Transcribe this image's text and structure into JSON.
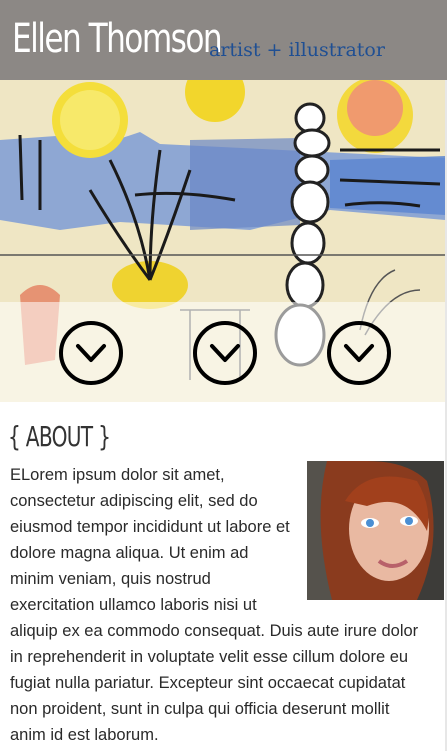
{
  "header": {
    "title": "Ellen Thomson",
    "tagline": "artist + illustrator"
  },
  "hero": {
    "image_alt": "painting",
    "nav_buttons": [
      "chevron-down-icon",
      "chevron-down-icon",
      "chevron-down-icon"
    ]
  },
  "about": {
    "heading": "{ ABOUT }",
    "photo_alt": "portrait photo",
    "paragraph": "ELorem ipsum dolor sit amet, consectetur adipiscing elit, sed do eiusmod tempor incididunt ut labore et dolore magna aliqua. Ut enim ad minim veniam, quis nostrud exercitation ullamco laboris nisi ut aliquip ex ea commodo consequat. Duis aute irure dolor in reprehenderit in voluptate velit esse cillum dolore eu fugiat nulla pariatur. Excepteur sint occaecat cupidatat non proident, sunt in culpa qui officia deserunt mollit anim id est laborum."
  },
  "colors": {
    "header_bg": "#8c8885",
    "title": "#ffffff",
    "tagline": "#1f4f93",
    "text": "#2a2a2a"
  }
}
